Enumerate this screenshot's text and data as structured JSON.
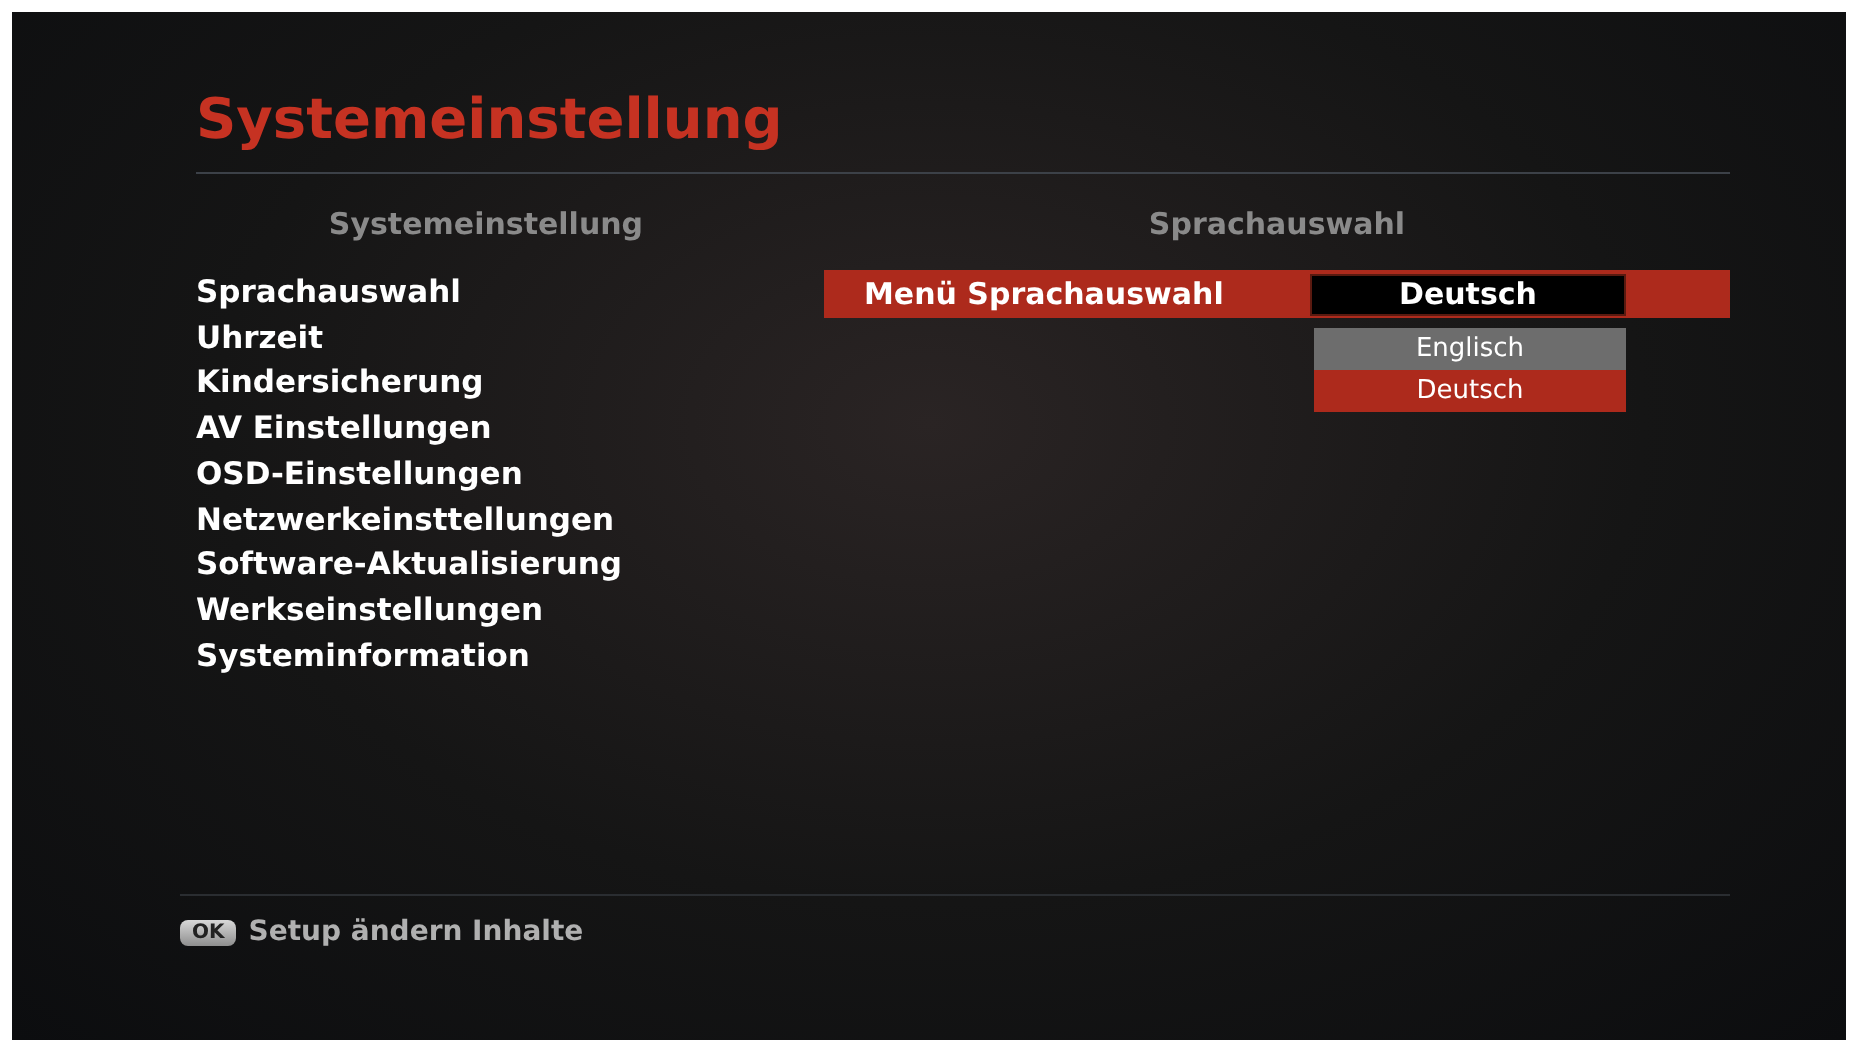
{
  "title": "Systemeinstellung",
  "menu": {
    "heading": "Systemeinstellung",
    "items": [
      "Sprachauswahl",
      "Uhrzeit",
      "Kindersicherung",
      "AV Einstellungen",
      "OSD-Einstellungen",
      "Netzwerkeinsttellungen",
      "Software-Aktualisierung",
      "Werkseinstellungen",
      "Systeminformation"
    ]
  },
  "panel": {
    "heading": "Sprachauswahl",
    "setting": {
      "label": "Menü Sprachauswahl",
      "value": "Deutsch"
    },
    "options": [
      {
        "label": "Englisch",
        "selected": false
      },
      {
        "label": "Deutsch",
        "selected": true
      }
    ]
  },
  "footer": {
    "key": "OK",
    "hint": "Setup ändern Inhalte"
  }
}
